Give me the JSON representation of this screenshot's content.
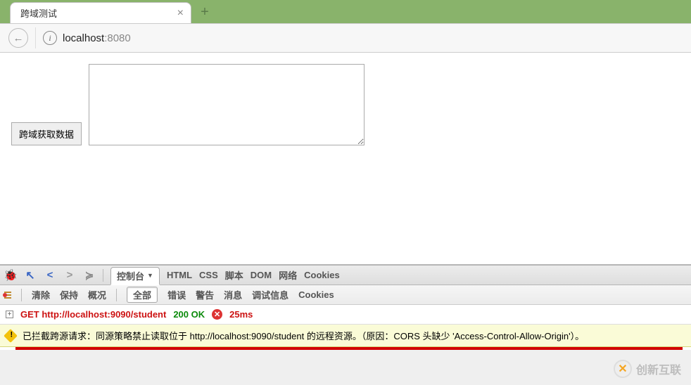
{
  "tab": {
    "title": "跨域测试"
  },
  "address": {
    "host": "localhost",
    "port": ":8080"
  },
  "page": {
    "textarea_value": "",
    "button_label": "跨域获取数据"
  },
  "devtools": {
    "tabs": [
      "控制台",
      "HTML",
      "CSS",
      "脚本",
      "DOM",
      "网络",
      "Cookies"
    ],
    "row2": {
      "clear": "清除",
      "persist": "保持",
      "overview": "概况",
      "all": "全部",
      "errors": "错误",
      "warnings": "警告",
      "messages": "消息",
      "debug": "调试信息",
      "cookies": "Cookies"
    },
    "request": {
      "method": "GET",
      "url": "http://localhost:9090/student",
      "status": "200 OK",
      "time": "25ms"
    },
    "warning": "已拦截跨源请求：同源策略禁止读取位于 http://localhost:9090/student 的远程资源。（原因：CORS 头缺少 'Access-Control-Allow-Origin'）。"
  },
  "watermark": "创新互联"
}
